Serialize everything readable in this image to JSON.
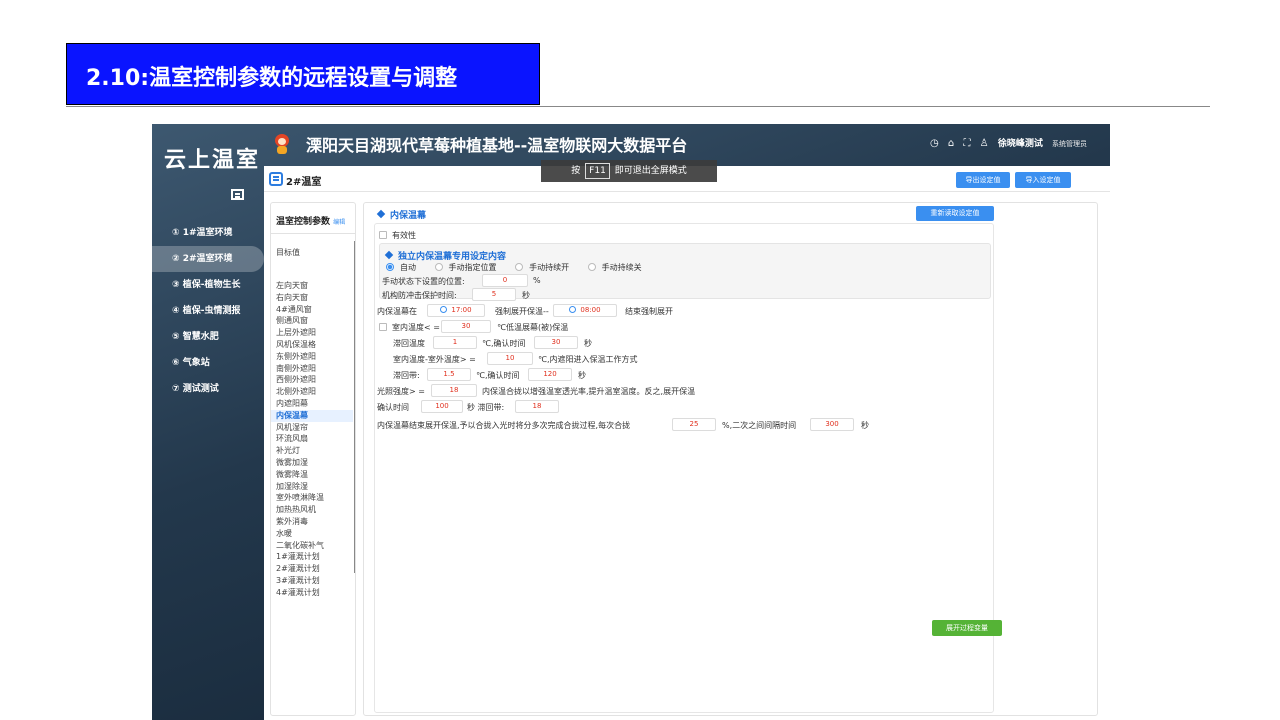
{
  "slide": {
    "title": "2.10:温室控制参数的远程设置与调整"
  },
  "app": {
    "brand": "云上温室",
    "title": "溧阳天目湖现代草莓种植基地--温室物联网大数据平台",
    "user": {
      "name": "徐晓峰测试",
      "role": "系统管理员"
    },
    "fullscreen_hint": {
      "prefix": "按",
      "key": "F11",
      "suffix": "即可退出全屏模式"
    },
    "colors": {
      "primary": "#3a8ff0",
      "accent_green": "#55b336",
      "value_red": "#e0301e",
      "slide_blue": "#0a14ff"
    }
  },
  "sidebar": {
    "items": [
      {
        "label": "① 1#温室环境",
        "active": false
      },
      {
        "label": "② 2#温室环境",
        "active": true
      },
      {
        "label": "③ 植保-植物生长",
        "active": false
      },
      {
        "label": "④ 植保-虫情测报",
        "active": false
      },
      {
        "label": "⑤ 智慧水肥",
        "active": false
      },
      {
        "label": "⑥ 气象站",
        "active": false
      },
      {
        "label": "⑦ 测试测试",
        "active": false
      }
    ]
  },
  "main": {
    "greenhouse_title": "2#温室",
    "export_button": "导出设定值",
    "import_button": "导入设定值"
  },
  "params_panel": {
    "title": "温室控制参数",
    "edit": "编辑",
    "target_label": "目标值",
    "items": [
      "左向天窗",
      "右向天窗",
      "4#通风窗",
      "侧通风窗",
      "上层外遮阳",
      "风机保温格",
      "东侧外遮阳",
      "南侧外遮阳",
      "西侧外遮阳",
      "北侧外遮阳",
      "内遮阳幕",
      "内保温幕",
      "风机湿帘",
      "环流风扇",
      "补光灯",
      "微雾加湿",
      "微雾降温",
      "加湿除湿",
      "室外喷淋降温",
      "加热热风机",
      "紫外消毒",
      "水暖",
      "二氧化碳补气",
      "1#灌溉计划",
      "2#灌溉计划",
      "3#灌溉计划",
      "4#灌溉计划"
    ],
    "active_index": 11
  },
  "content": {
    "section_title": "内保温幕",
    "reread_button": "重新读取设定值",
    "validity_label": "有效性",
    "independent": {
      "title": "独立内保温幕专用设定内容",
      "modes": [
        "自动",
        "手动指定位置",
        "手动持续开",
        "手动持续关"
      ],
      "selected_mode": 0,
      "manual_position_label": "手动状态下设置的位置:",
      "manual_position_value": "0",
      "manual_position_unit": "%",
      "anti_impact_label": "机构防冲击保护时间:",
      "anti_impact_value": "5",
      "anti_impact_unit": "秒"
    },
    "schedule": {
      "label1": "内保温幕在",
      "time1": "17:00",
      "label2": "强制展开保温--",
      "time2": "08:00",
      "label3": "结束强制展开"
    },
    "low_temp": {
      "label": "室内温度< =",
      "value": "30",
      "suffix": "℃低温展幕(被)保温",
      "hyst_label": "滞回温度",
      "hyst_value": "1",
      "hyst_suffix": "℃,确认时间",
      "confirm_value": "30",
      "confirm_unit": "秒"
    },
    "diff_temp": {
      "label": "室内温度-室外温度> =",
      "value": "10",
      "suffix": "℃,内遮阳进入保温工作方式",
      "band_label": "滞回带:",
      "band_value": "1.5",
      "band_suffix": "℃,确认时间",
      "confirm_value": "120",
      "confirm_unit": "秒"
    },
    "light": {
      "label": "光照强度> =",
      "value": "18",
      "suffix": "内保温合拢以增强温室透光率,提升温室温度。反之,展开保温",
      "confirm_label": "确认时间",
      "confirm_value": "100",
      "confirm_unit": "秒 滞回带:",
      "band_value": "18"
    },
    "staged": {
      "label": "内保温幕结束展开保温,予以合拢入光时将分多次完成合拢过程,每次合拢",
      "step_value": "25",
      "mid": "%,二次之间间隔时间",
      "interval_value": "300",
      "unit": "秒"
    },
    "expand_button": "展开过程变量"
  }
}
